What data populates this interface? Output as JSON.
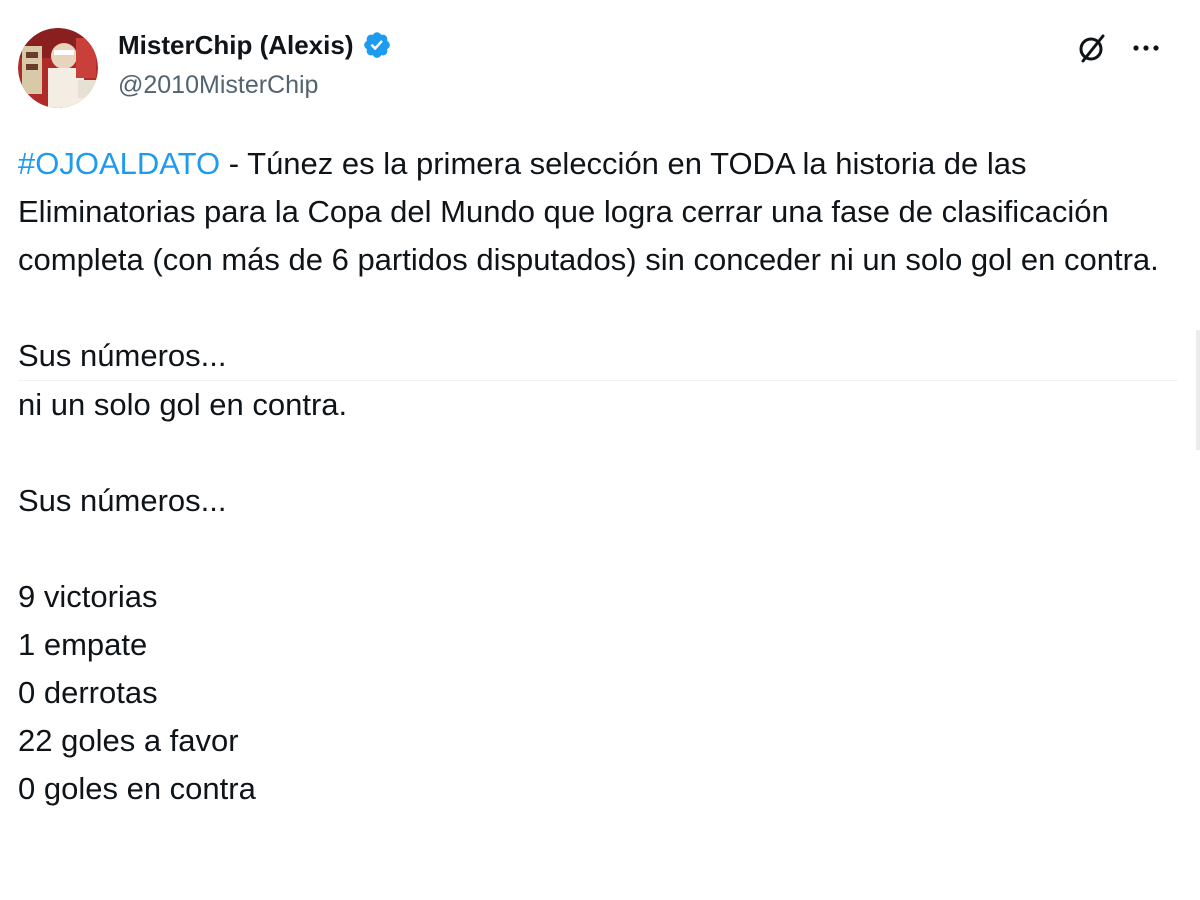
{
  "author": {
    "display_name": "MisterChip (Alexis)",
    "handle": "@2010MisterChip",
    "verified": true,
    "verified_color": "#1d9bf0",
    "avatar_icon": "profile-photo"
  },
  "actions": {
    "grok_icon": "grok-icon",
    "more_icon": "more-dots-icon",
    "more_label": "···"
  },
  "tweet": {
    "hashtag": "#OJOALDATO",
    "intro": " - Túnez es la primera selección en TODA la historia de las Eliminatorias para la Copa del Mundo que logra cerrar una fase de clasificación completa (con más de 6 partidos disputados) sin conceder ni un solo gol en contra.",
    "lead_1": "Sus números...",
    "repeat_line": "ni un solo gol en contra.",
    "lead_2": "Sus números...",
    "stats": [
      "9 victorias",
      "1 empate",
      "0 derrotas",
      "22 goles a favor",
      "0 goles en contra"
    ]
  },
  "colors": {
    "text": "#0f1419",
    "secondary": "#536471",
    "link": "#1d9bf0"
  }
}
